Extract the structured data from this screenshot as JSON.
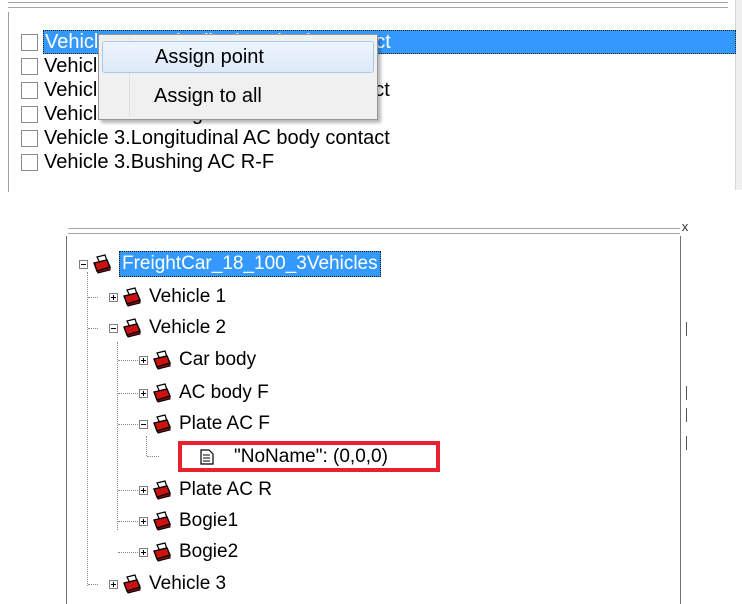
{
  "check_list": {
    "items": [
      {
        "label": "Vehicle 1.Longitudinal AC body contact",
        "checked": false,
        "selected": true
      },
      {
        "label": "Vehicle 1.Bushing AC  R-F",
        "checked": false,
        "selected": false
      },
      {
        "label": "Vehicle 2.Longitudinal AC body contact",
        "checked": false,
        "selected": false
      },
      {
        "label": "Vehicle 2.Bushing AC  R-F",
        "checked": false,
        "selected": false
      },
      {
        "label": "Vehicle 3.Longitudinal AC body contact",
        "checked": false,
        "selected": false
      },
      {
        "label": "Vehicle 3.Bushing AC  R-F",
        "checked": false,
        "selected": false
      }
    ]
  },
  "context_menu": {
    "items": [
      {
        "label": "Assign point",
        "hovered": true
      },
      {
        "label": "Assign to all",
        "hovered": false
      }
    ]
  },
  "tree": {
    "close_glyph": "x",
    "root": {
      "label": "FreightCar_18_100_3Vehicles",
      "selected": true
    },
    "nodes": [
      {
        "label": "Vehicle 1",
        "expanded": false
      },
      {
        "label": "Vehicle 2",
        "expanded": true
      },
      {
        "label": "Car body",
        "expanded": false
      },
      {
        "label": "AC body F",
        "expanded": false
      },
      {
        "label": "Plate AC F",
        "expanded": true
      },
      {
        "label": "\"NoName\": (0,0,0)",
        "leaf": true
      },
      {
        "label": "Plate AC R",
        "expanded": false
      },
      {
        "label": "Bogie1",
        "expanded": false
      },
      {
        "label": "Bogie2",
        "expanded": false
      },
      {
        "label": "Vehicle 3",
        "expanded": false
      }
    ]
  },
  "colors": {
    "selection": "#3399ff",
    "highlight_box": "#e8212e",
    "icon_red": "#cc1111"
  },
  "icons": {
    "node": "body-icon",
    "leaf": "point-icon",
    "expand": "plus-expander-icon",
    "collapse": "minus-expander-icon"
  }
}
